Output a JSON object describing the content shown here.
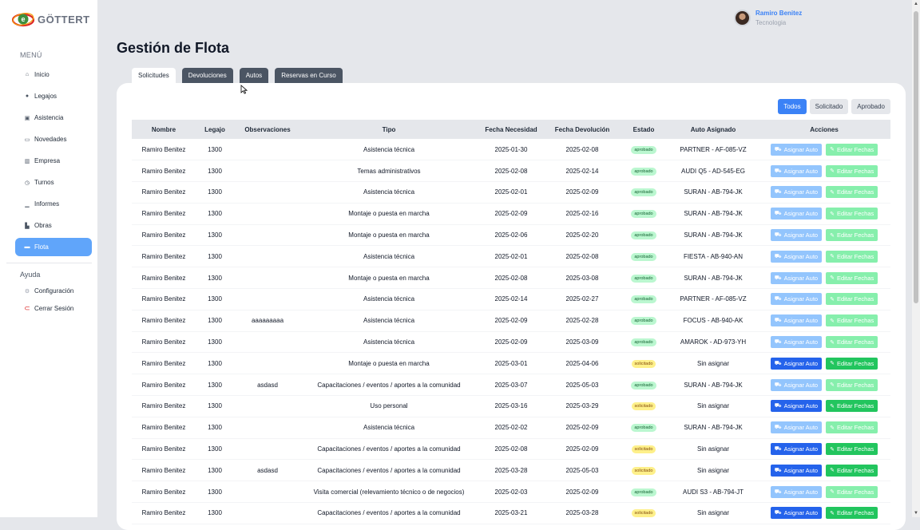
{
  "brand": {
    "name": "GÖTTERT"
  },
  "sidebar": {
    "menu_title": "MENÚ",
    "items": [
      {
        "label": "Inicio",
        "icon": "home-icon",
        "glyph": "⌂"
      },
      {
        "label": "Legajos",
        "icon": "user-icon",
        "glyph": "●"
      },
      {
        "label": "Asistencia",
        "icon": "clipboard-icon",
        "glyph": "▣"
      },
      {
        "label": "Novedades",
        "icon": "card-icon",
        "glyph": "▭"
      },
      {
        "label": "Empresa",
        "icon": "building-icon",
        "glyph": "▥"
      },
      {
        "label": "Turnos",
        "icon": "clock-icon",
        "glyph": "◷"
      },
      {
        "label": "Informes",
        "icon": "chart-icon",
        "glyph": "▁"
      },
      {
        "label": "Obras",
        "icon": "industry-icon",
        "glyph": "▙"
      },
      {
        "label": "Flota",
        "icon": "car-icon",
        "glyph": "▬",
        "active": true
      }
    ],
    "help_title": "Ayuda",
    "settings_label": "Configuración",
    "logout_label": "Cerrar Sesión"
  },
  "user": {
    "name": "Ramiro Benitez",
    "role": "Tecnologia"
  },
  "page": {
    "title": "Gestión de Flota"
  },
  "tabs": [
    {
      "label": "Solicitudes",
      "active": true
    },
    {
      "label": "Devoluciones"
    },
    {
      "label": "Autos"
    },
    {
      "label": "Reservas en Curso"
    }
  ],
  "filters": [
    {
      "label": "Todos",
      "active": true
    },
    {
      "label": "Solicitado"
    },
    {
      "label": "Aprobado"
    }
  ],
  "table": {
    "headers": [
      "Nombre",
      "Legajo",
      "Observaciones",
      "Tipo",
      "Fecha Necesidad",
      "Fecha Devolución",
      "Estado",
      "Auto Asignado",
      "Acciones"
    ],
    "assign_label": "Asignar Auto",
    "edit_label": "Editar Fechas",
    "rows": [
      [
        "Ramiro Benitez",
        "1300",
        "",
        "Asistencia técnica",
        "2025-01-30",
        "2025-02-08",
        "aprobado",
        "PARTNER - AF-085-VZ"
      ],
      [
        "Ramiro Benitez",
        "1300",
        "",
        "Temas administrativos",
        "2025-02-08",
        "2025-02-14",
        "aprobado",
        "AUDI Q5 - AD-545-EG"
      ],
      [
        "Ramiro Benitez",
        "1300",
        "",
        "Asistencia técnica",
        "2025-02-01",
        "2025-02-09",
        "aprobado",
        "SURAN - AB-794-JK"
      ],
      [
        "Ramiro Benitez",
        "1300",
        "",
        "Montaje o puesta en marcha",
        "2025-02-09",
        "2025-02-16",
        "aprobado",
        "SURAN - AB-794-JK"
      ],
      [
        "Ramiro Benitez",
        "1300",
        "",
        "Montaje o puesta en marcha",
        "2025-02-06",
        "2025-02-20",
        "aprobado",
        "SURAN - AB-794-JK"
      ],
      [
        "Ramiro Benitez",
        "1300",
        "",
        "Asistencia técnica",
        "2025-02-01",
        "2025-02-08",
        "aprobado",
        "FIESTA - AB-940-AN"
      ],
      [
        "Ramiro Benitez",
        "1300",
        "",
        "Montaje o puesta en marcha",
        "2025-02-08",
        "2025-03-08",
        "aprobado",
        "SURAN - AB-794-JK"
      ],
      [
        "Ramiro Benitez",
        "1300",
        "",
        "Asistencia técnica",
        "2025-02-14",
        "2025-02-27",
        "aprobado",
        "PARTNER - AF-085-VZ"
      ],
      [
        "Ramiro Benitez",
        "1300",
        "aaaaaaaaa",
        "Asistencia técnica",
        "2025-02-09",
        "2025-02-28",
        "aprobado",
        "FOCUS - AB-940-AK"
      ],
      [
        "Ramiro Benitez",
        "1300",
        "",
        "Asistencia técnica",
        "2025-02-09",
        "2025-03-09",
        "aprobado",
        "AMAROK - AD-973-YH"
      ],
      [
        "Ramiro Benitez",
        "1300",
        "",
        "Montaje o puesta en marcha",
        "2025-03-01",
        "2025-04-06",
        "solicitado",
        "Sin asignar"
      ],
      [
        "Ramiro Benitez",
        "1300",
        "asdasd",
        "Capacitaciones / eventos / aportes a la comunidad",
        "2025-03-07",
        "2025-05-03",
        "aprobado",
        "SURAN - AB-794-JK"
      ],
      [
        "Ramiro Benitez",
        "1300",
        "",
        "Uso personal",
        "2025-03-16",
        "2025-03-29",
        "solicitado",
        "Sin asignar"
      ],
      [
        "Ramiro Benitez",
        "1300",
        "",
        "Asistencia técnica",
        "2025-02-02",
        "2025-02-09",
        "aprobado",
        "SURAN - AB-794-JK"
      ],
      [
        "Ramiro Benitez",
        "1300",
        "",
        "Capacitaciones / eventos / aportes a la comunidad",
        "2025-02-08",
        "2025-02-09",
        "solicitado",
        "Sin asignar"
      ],
      [
        "Ramiro Benitez",
        "1300",
        "asdasd",
        "Capacitaciones / eventos / aportes a la comunidad",
        "2025-03-28",
        "2025-05-03",
        "solicitado",
        "Sin asignar"
      ],
      [
        "Ramiro Benitez",
        "1300",
        "",
        "Visita comercial (relevamiento técnico o de negocios)",
        "2025-02-03",
        "2025-02-09",
        "aprobado",
        "AUDI S3 - AB-794-JT"
      ],
      [
        "Ramiro Benitez",
        "1300",
        "",
        "Capacitaciones / eventos / aportes a la comunidad",
        "2025-03-21",
        "2025-03-28",
        "solicitado",
        "Sin asignar"
      ]
    ]
  },
  "colors": {
    "accent": "#3b82f6",
    "active_nav": "#60a5fa",
    "approved_bg": "#bbf7d0",
    "requested_bg": "#fef08a",
    "edit_green": "#22c55e"
  }
}
